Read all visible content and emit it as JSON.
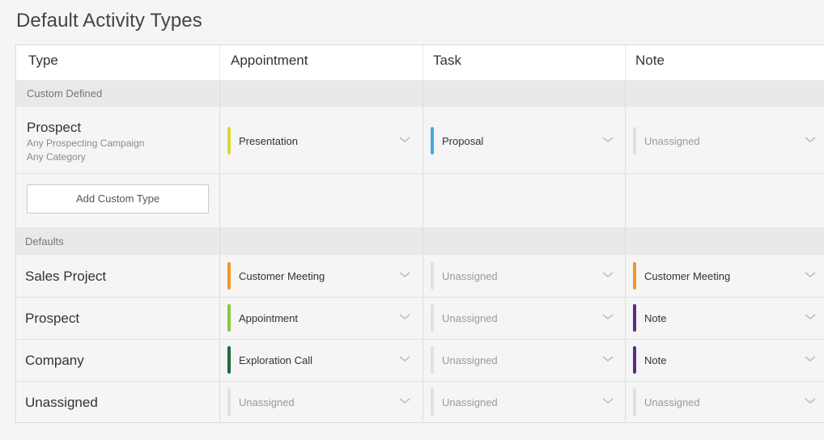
{
  "page": {
    "title": "Default Activity Types"
  },
  "columns": {
    "type": "Type",
    "appointment": "Appointment",
    "task": "Task",
    "note": "Note"
  },
  "custom_section": {
    "label": "Custom Defined",
    "rows": [
      {
        "label": "Prospect",
        "sub1": "Any Prospecting Campaign",
        "sub2": "Any Category",
        "appointment": {
          "value": "Presentation",
          "color": "#d9d93a",
          "assigned": true
        },
        "task": {
          "value": "Proposal",
          "color": "#45a9e0",
          "assigned": true
        },
        "note": {
          "value": "Unassigned",
          "color": "#e0e0e0",
          "assigned": false
        }
      }
    ],
    "add_button": "Add Custom Type"
  },
  "defaults_section": {
    "label": "Defaults",
    "rows": [
      {
        "label": "Sales Project",
        "appointment": {
          "value": "Customer Meeting",
          "color": "#f0982d",
          "assigned": true
        },
        "task": {
          "value": "Unassigned",
          "color": "#e0e0e0",
          "assigned": false
        },
        "note": {
          "value": "Customer Meeting",
          "color": "#f0982d",
          "assigned": true
        }
      },
      {
        "label": "Prospect",
        "appointment": {
          "value": "Appointment",
          "color": "#8dc63f",
          "assigned": true
        },
        "task": {
          "value": "Unassigned",
          "color": "#e0e0e0",
          "assigned": false
        },
        "note": {
          "value": "Note",
          "color": "#5e2a86",
          "assigned": true
        }
      },
      {
        "label": "Company",
        "appointment": {
          "value": "Exploration Call",
          "color": "#1e6b3c",
          "assigned": true
        },
        "task": {
          "value": "Unassigned",
          "color": "#e0e0e0",
          "assigned": false
        },
        "note": {
          "value": "Note",
          "color": "#5e2a86",
          "assigned": true
        }
      },
      {
        "label": "Unassigned",
        "appointment": {
          "value": "Unassigned",
          "color": "#e0e0e0",
          "assigned": false
        },
        "task": {
          "value": "Unassigned",
          "color": "#e0e0e0",
          "assigned": false
        },
        "note": {
          "value": "Unassigned",
          "color": "#e0e0e0",
          "assigned": false
        }
      }
    ]
  }
}
